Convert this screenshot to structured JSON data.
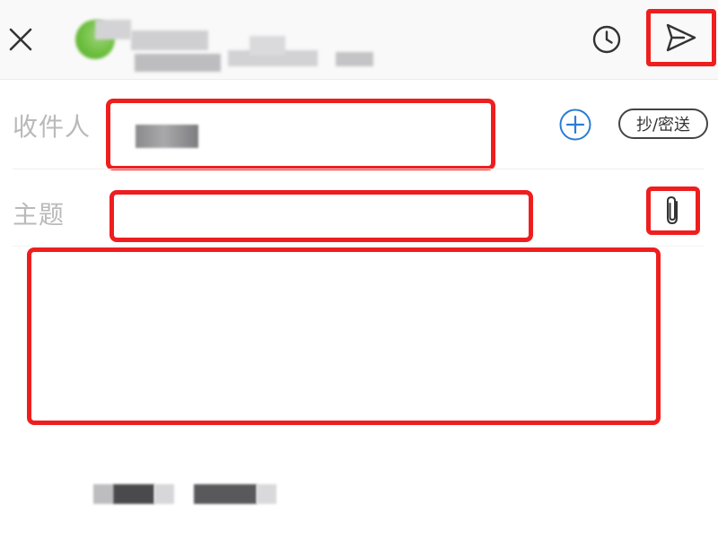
{
  "header": {
    "close_icon": "close-icon",
    "timer_icon": "clock-icon",
    "send_icon": "paper-plane-icon"
  },
  "fields": {
    "to": {
      "label": "收件人",
      "add_icon": "plus-circle-icon",
      "cc_label": "抄/密送"
    },
    "subject": {
      "label": "主题",
      "attach_icon": "paperclip-icon"
    }
  },
  "colors": {
    "highlight": "#ef1e1e",
    "accent_blue": "#2b7cd3",
    "avatar_green": "#6cbf3e",
    "label_gray": "#b9b9b9"
  }
}
